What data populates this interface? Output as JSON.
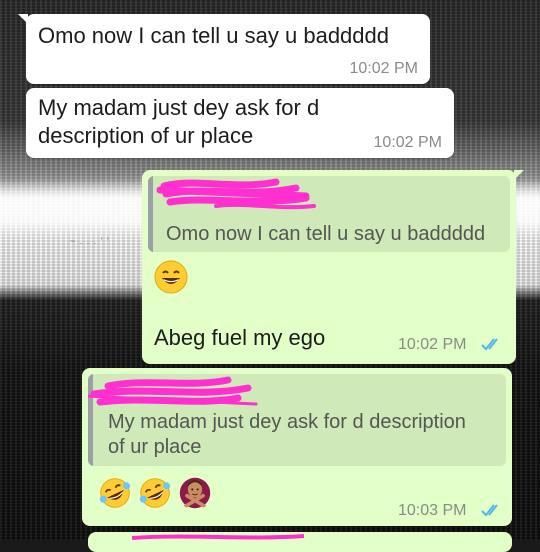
{
  "messages": [
    {
      "text": "Omo now I can tell u say u baddddd",
      "time": "10:02 PM",
      "direction": "incoming"
    },
    {
      "text": "My madam just dey ask for d description of ur place",
      "line1": "My madam just dey ask for d",
      "line2": "description of ur place",
      "time": "10:02 PM",
      "direction": "incoming"
    },
    {
      "quoted_text": "Omo now I can tell u say u baddddd",
      "emoji": [
        "grinning-face"
      ],
      "text": "Abeg fuel my ego",
      "time": "10:02 PM",
      "status": "read",
      "direction": "outgoing"
    },
    {
      "quoted_line1": "My madam just dey ask for d description",
      "quoted_line2": "of ur place",
      "emoji": [
        "rolling-on-floor-laughing",
        "rolling-on-floor-laughing",
        "person-gesturing-no"
      ],
      "time": "10:03 PM",
      "status": "read",
      "direction": "outgoing"
    }
  ],
  "colors": {
    "incoming_bubble": "#ffffff",
    "outgoing_bubble": "#e1ffc7",
    "quote_background": "#cfe9b9",
    "read_ticks": "#4fb6ec",
    "redaction": "#ff2fd0"
  }
}
